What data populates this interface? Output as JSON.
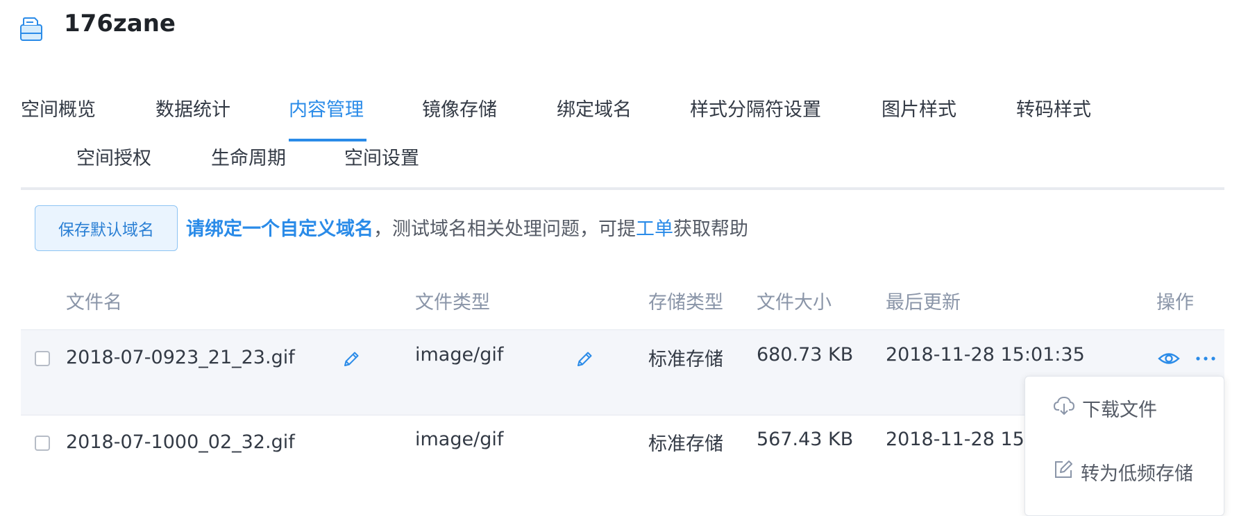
{
  "header": {
    "bucket_name": "176zane"
  },
  "tabs": [
    {
      "label": "空间概览",
      "active": false
    },
    {
      "label": "数据统计",
      "active": false
    },
    {
      "label": "内容管理",
      "active": true
    },
    {
      "label": "镜像存储",
      "active": false
    },
    {
      "label": "绑定域名",
      "active": false
    },
    {
      "label": "样式分隔符设置",
      "active": false
    },
    {
      "label": "图片样式",
      "active": false
    },
    {
      "label": "转码样式",
      "active": false
    },
    {
      "label": "空间授权",
      "active": false
    },
    {
      "label": "生命周期",
      "active": false
    },
    {
      "label": "空间设置",
      "active": false
    }
  ],
  "toolbar": {
    "save_default_domain": "保存默认域名",
    "notice_link": "请绑定一个自定义域名",
    "notice_comma": "，",
    "notice_text": "测试域名相关处理问题，可提",
    "notice_ticket": "工单",
    "notice_tail": "获取帮助"
  },
  "table": {
    "columns": [
      "文件名",
      "文件类型",
      "存储类型",
      "文件大小",
      "最后更新",
      "操作"
    ],
    "rows": [
      {
        "name": "2018-07-0923_21_23.gif",
        "type": "image/gif",
        "storage": "标准存储",
        "size": "680.73 KB",
        "updated": "2018-11-28 15:01:35",
        "selected": false
      },
      {
        "name": "2018-07-1000_02_32.gif",
        "type": "image/gif",
        "storage": "标准存储",
        "size": "567.43 KB",
        "updated": "2018-11-28 15:",
        "selected": false
      }
    ]
  },
  "dropdown": {
    "items": [
      {
        "label": "下载文件",
        "icon": "cloud-download-icon"
      },
      {
        "label": "转为低频存储",
        "icon": "edit-icon"
      }
    ]
  },
  "colors": {
    "accent": "#2a8be8",
    "header_text": "#8a95a8",
    "row_hover": "#f4f6fa"
  }
}
